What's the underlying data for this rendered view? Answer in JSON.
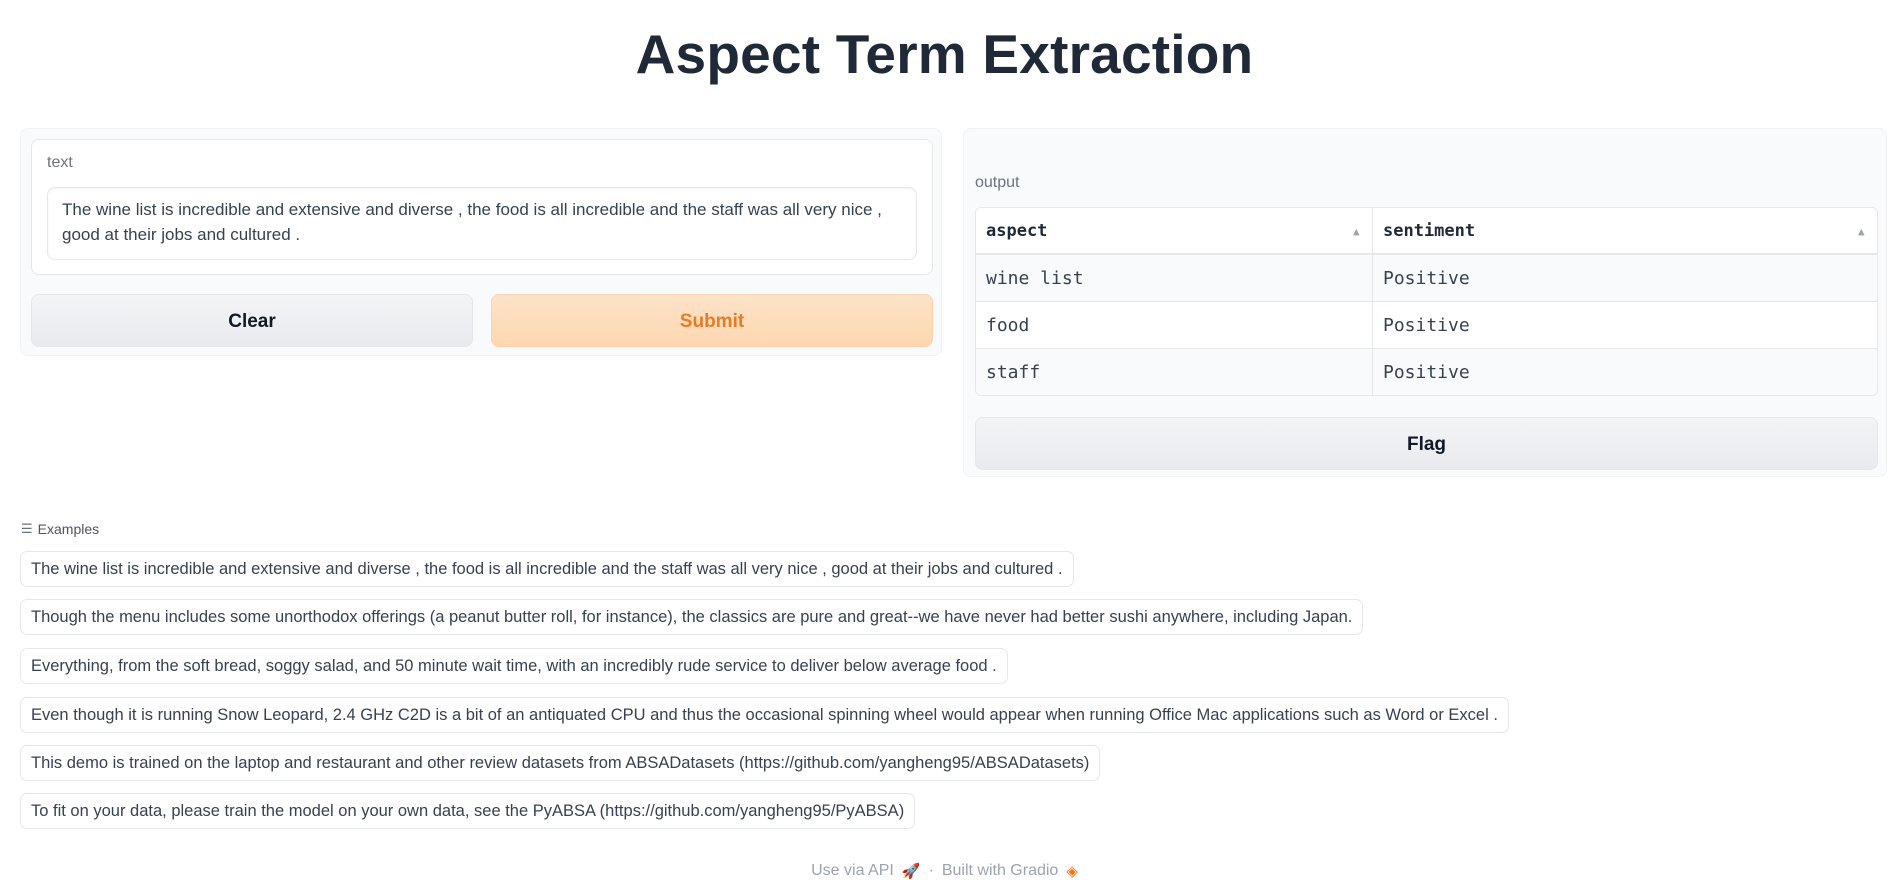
{
  "page": {
    "title": "Aspect Term Extraction"
  },
  "input": {
    "label": "text",
    "value": "The wine list is incredible and extensive and diverse , the food is all incredible and the staff was all very nice , good at their jobs and cultured ."
  },
  "buttons": {
    "clear": "Clear",
    "submit": "Submit",
    "flag": "Flag"
  },
  "output": {
    "label": "output",
    "columns": [
      "aspect",
      "sentiment"
    ],
    "rows": [
      {
        "aspect": "wine list",
        "sentiment": "Positive"
      },
      {
        "aspect": "food",
        "sentiment": "Positive"
      },
      {
        "aspect": "staff",
        "sentiment": "Positive"
      }
    ]
  },
  "examples": {
    "header": "Examples",
    "items": [
      "The wine list is incredible and extensive and diverse , the food is all incredible and the staff was all very nice , good at their jobs and cultured .",
      "Though the menu includes some unorthodox offerings (a peanut butter roll, for instance), the classics are pure and great--we have never had better sushi anywhere, including Japan.",
      "Everything, from the soft bread, soggy salad, and 50 minute wait time, with an incredibly rude service to deliver below average food .",
      "Even though it is running Snow Leopard, 2.4 GHz C2D is a bit of an antiquated CPU and thus the occasional spinning wheel would appear when running Office Mac applications such as Word or Excel .",
      "This demo is trained on the laptop and restaurant and other review datasets from ABSADatasets (https://github.com/yangheng95/ABSADatasets)",
      "To fit on your data, please train the model on your own data, see the PyABSA (https://github.com/yangheng95/PyABSA)"
    ]
  },
  "footer": {
    "api": "Use via API",
    "separator": "·",
    "built": "Built with Gradio",
    "icons": [
      "rocket-icon",
      "gradio-logo-icon"
    ]
  },
  "colors": {
    "accent": "#ea7b22",
    "submit_bg": "#fdd7b0"
  }
}
